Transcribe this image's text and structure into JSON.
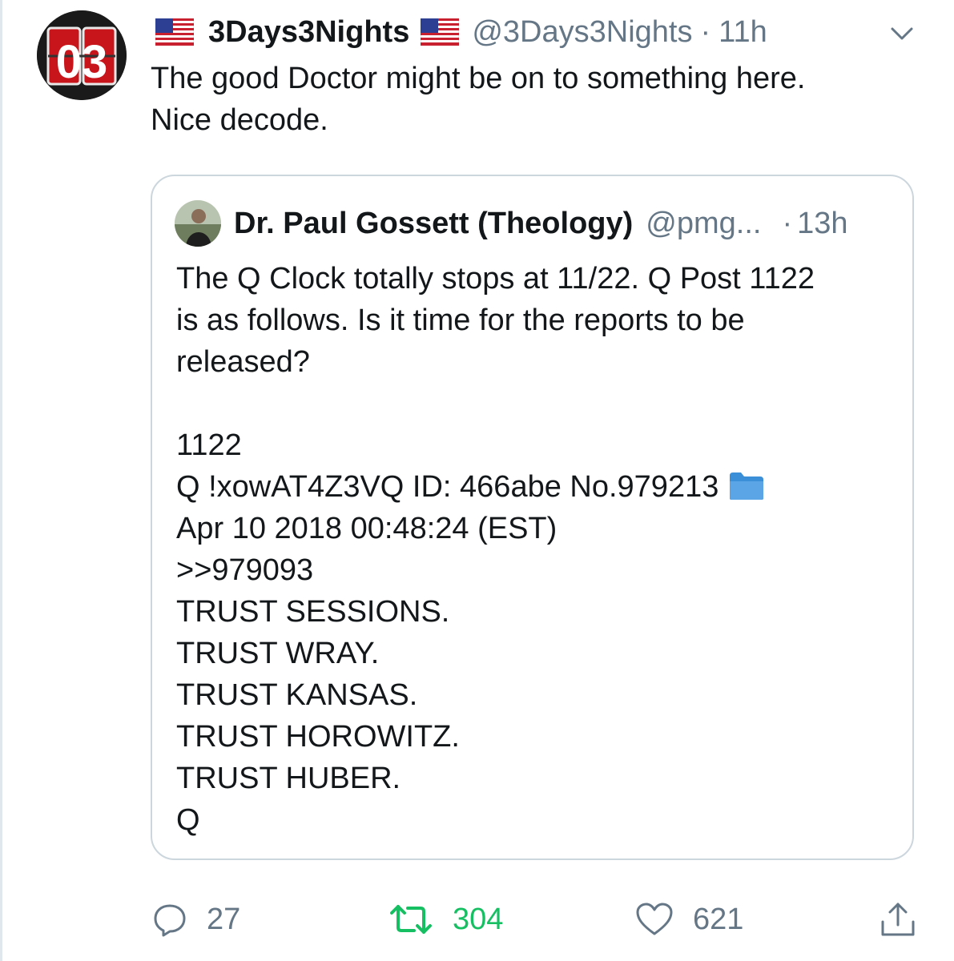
{
  "tweet": {
    "display_name": "3Days3Nights",
    "handle": "@3Days3Nights",
    "separator": "·",
    "timestamp": "11h",
    "avatar_text": "03",
    "text_line1": "The good Doctor might be on to something here.",
    "text_line2": "Nice decode."
  },
  "quoted": {
    "display_name": "Dr. Paul Gossett (Theology)",
    "handle": "@pmg...",
    "separator": "·",
    "timestamp": "13h",
    "para": [
      "The Q Clock totally stops at 11/22. Q Post 1122",
      "is as follows. Is it time for the reports to be",
      "released?"
    ],
    "lines": [
      "1122",
      "Q !xowAT4Z3VQ ID: 466abe No.979213",
      "Apr 10 2018 00:48:24 (EST)",
      ">>979093",
      "TRUST SESSIONS.",
      "TRUST WRAY.",
      "TRUST KANSAS.",
      "TRUST HOROWITZ.",
      "TRUST HUBER.",
      "Q"
    ]
  },
  "actions": {
    "reply_count": "27",
    "retweet_count": "304",
    "like_count": "621"
  },
  "icons": {
    "flag": "us-flag-icon",
    "caret": "chevron-down-icon",
    "folder": "folder-icon",
    "reply": "reply-icon",
    "retweet": "retweet-icon",
    "like": "heart-icon",
    "share": "share-icon"
  },
  "colors": {
    "text": "#14171a",
    "secondary": "#657786",
    "retweet_active": "#17bf63",
    "card_border": "#ccd6dd",
    "folder": "#5ba4e5"
  }
}
